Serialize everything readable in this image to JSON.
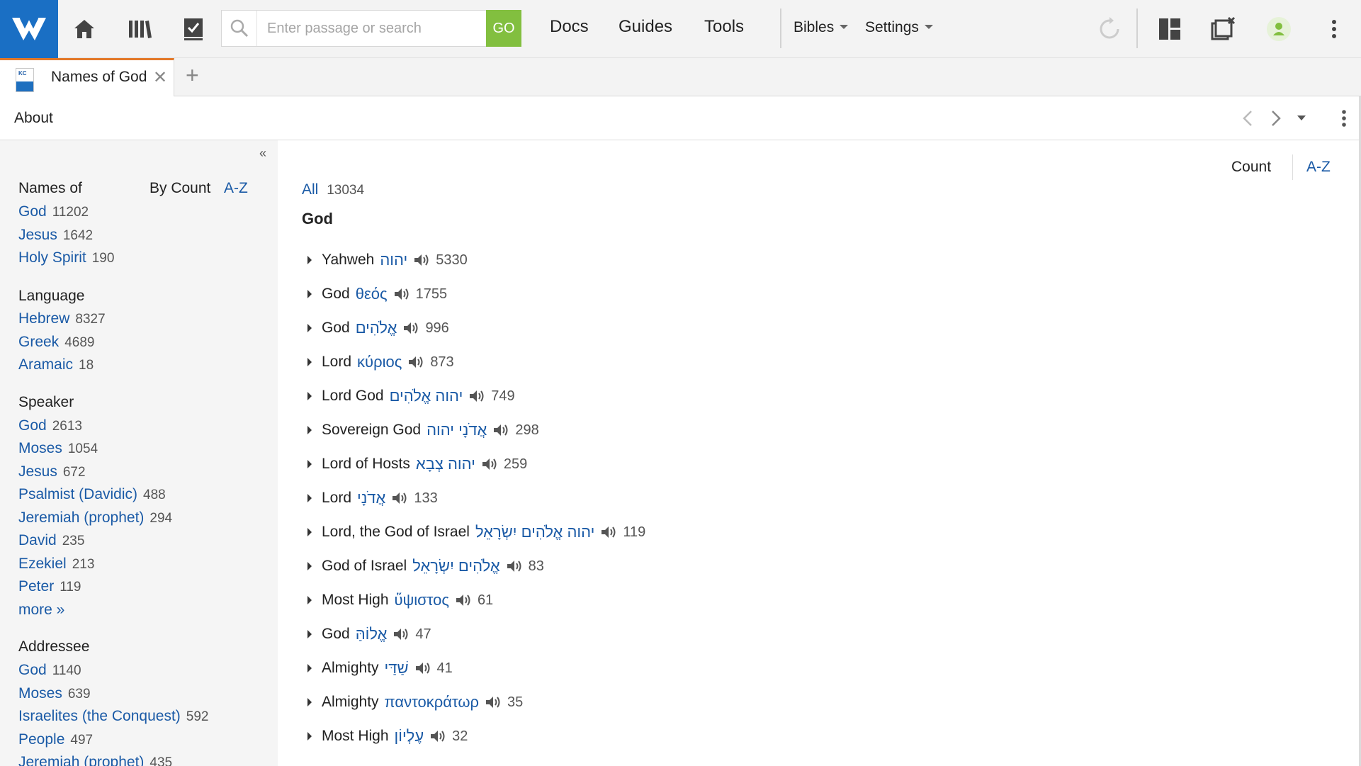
{
  "topbar": {
    "search_placeholder": "Enter passage or search",
    "go_label": "GO",
    "nav": [
      "Docs",
      "Guides",
      "Tools"
    ],
    "bibles_label": "Bibles",
    "settings_label": "Settings",
    "avatar_color": "#82bf3f",
    "brand_color": "#1a6fc4"
  },
  "tab": {
    "title": "Names of God",
    "thumb_text": "KC"
  },
  "panel": {
    "title": "About"
  },
  "sidebar": {
    "names_header": "Names of",
    "sort_by_count": "By Count",
    "sort_az": "A-Z",
    "names": [
      {
        "label": "God",
        "count": "11202"
      },
      {
        "label": "Jesus",
        "count": "1642"
      },
      {
        "label": "Holy Spirit",
        "count": "190"
      }
    ],
    "language_header": "Language",
    "languages": [
      {
        "label": "Hebrew",
        "count": "8327"
      },
      {
        "label": "Greek",
        "count": "4689"
      },
      {
        "label": "Aramaic",
        "count": "18"
      }
    ],
    "speaker_header": "Speaker",
    "speakers": [
      {
        "label": "God",
        "count": "2613"
      },
      {
        "label": "Moses",
        "count": "1054"
      },
      {
        "label": "Jesus",
        "count": "672"
      },
      {
        "label": "Psalmist (Davidic)",
        "count": "488"
      },
      {
        "label": "Jeremiah (prophet)",
        "count": "294"
      },
      {
        "label": "David",
        "count": "235"
      },
      {
        "label": "Ezekiel",
        "count": "213"
      },
      {
        "label": "Peter",
        "count": "119"
      }
    ],
    "more_label": "more »",
    "addressee_header": "Addressee",
    "addressees": [
      {
        "label": "God",
        "count": "1140"
      },
      {
        "label": "Moses",
        "count": "639"
      },
      {
        "label": "Israelites (the Conquest)",
        "count": "592"
      },
      {
        "label": "People",
        "count": "497"
      },
      {
        "label": "Jeremiah (prophet)",
        "count": "435"
      }
    ]
  },
  "main": {
    "sort_count": "Count",
    "sort_az": "A-Z",
    "all_label": "All",
    "all_count": "13034",
    "section_title": "God",
    "entries": [
      {
        "name": "Yahweh",
        "orig": "יהוה",
        "count": "5330"
      },
      {
        "name": "God",
        "orig": "θεός",
        "count": "1755"
      },
      {
        "name": "God",
        "orig": "אֱלֹהִים",
        "count": "996"
      },
      {
        "name": "Lord",
        "orig": "κύριος",
        "count": "873"
      },
      {
        "name": "Lord God",
        "orig": "יהוה אֱלֹהִים",
        "count": "749"
      },
      {
        "name": "Sovereign God",
        "orig": "אֲדֹנָי יהוה",
        "count": "298"
      },
      {
        "name": "Lord of Hosts",
        "orig": "יהוה צְבָא",
        "count": "259"
      },
      {
        "name": "Lord",
        "orig": "אֲדֹנָי",
        "count": "133"
      },
      {
        "name": "Lord, the God of Israel",
        "orig": "יהוה אֱלֹהִים יִשְׂרָאֵל",
        "count": "119"
      },
      {
        "name": "God of Israel",
        "orig": "אֱלֹהִים יִשְׂרָאֵל",
        "count": "83"
      },
      {
        "name": "Most High",
        "orig": "ὕψιστος",
        "count": "61"
      },
      {
        "name": "God",
        "orig": "אֱלוֹהַּ",
        "count": "47"
      },
      {
        "name": "Almighty",
        "orig": "שַׁדַּי",
        "count": "41"
      },
      {
        "name": "Almighty",
        "orig": "παντοκράτωρ",
        "count": "35"
      },
      {
        "name": "Most High",
        "orig": "עֶלְיוֹן",
        "count": "32"
      }
    ]
  }
}
